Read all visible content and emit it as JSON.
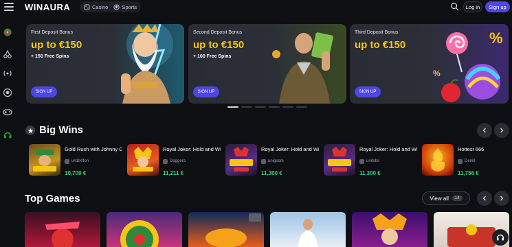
{
  "header": {
    "logo": "WINAURA",
    "modes": [
      {
        "label": "Casino",
        "icon": "casino-icon"
      },
      {
        "label": "Sports",
        "icon": "sports-ball-icon"
      }
    ],
    "login_label": "Log in",
    "signup_label": "Sign up"
  },
  "sidebar": {
    "icons": [
      "roulette-icon",
      "cherries-icon",
      "live-signal-icon",
      "soccer-ball-icon",
      "gamepad-icon",
      "support-headset-icon"
    ]
  },
  "banners": [
    {
      "label": "First Deposit Bonus",
      "amount": "up to €150",
      "spins": "+ 150 Free Spins",
      "cta": "SIGN UP",
      "art": "zeus-character"
    },
    {
      "label": "Second Deposit Bonus",
      "amount": "up to €150",
      "spins": "+ 100 Free Spins",
      "cta": "SIGN UP",
      "art": "adventurer-character"
    },
    {
      "label": "Third Deposit Bonus",
      "amount": "up to €150",
      "spins": "",
      "cta": "SIGN UP",
      "art": "candy-and-percent"
    }
  ],
  "carousel": {
    "total": 6,
    "active": 0
  },
  "big_wins": {
    "title": "Big Wins",
    "items": [
      {
        "game": "Gold Rush with Johnny Cash",
        "user": "un1b0fon",
        "amount": "10,709 €"
      },
      {
        "game": "Royal Joker: Hold and Win",
        "user": "Doggera",
        "amount": "11,211 €"
      },
      {
        "game": "Royal Joker: Hold and Win",
        "user": "unigsom",
        "amount": "11,300 €"
      },
      {
        "game": "Royal Joker: Hold and Win",
        "user": "unitobil",
        "amount": "11,300 €"
      },
      {
        "game": "Hottest 666",
        "user": "Denill",
        "amount": "11,756 €"
      }
    ]
  },
  "top_games": {
    "title": "Top Games",
    "view_all_label": "View all",
    "count": "14"
  },
  "colors": {
    "accent": "#4f46e5",
    "bonus_yellow": "#f5c518",
    "win_green": "#35d07f",
    "background": "#0e0f12"
  }
}
